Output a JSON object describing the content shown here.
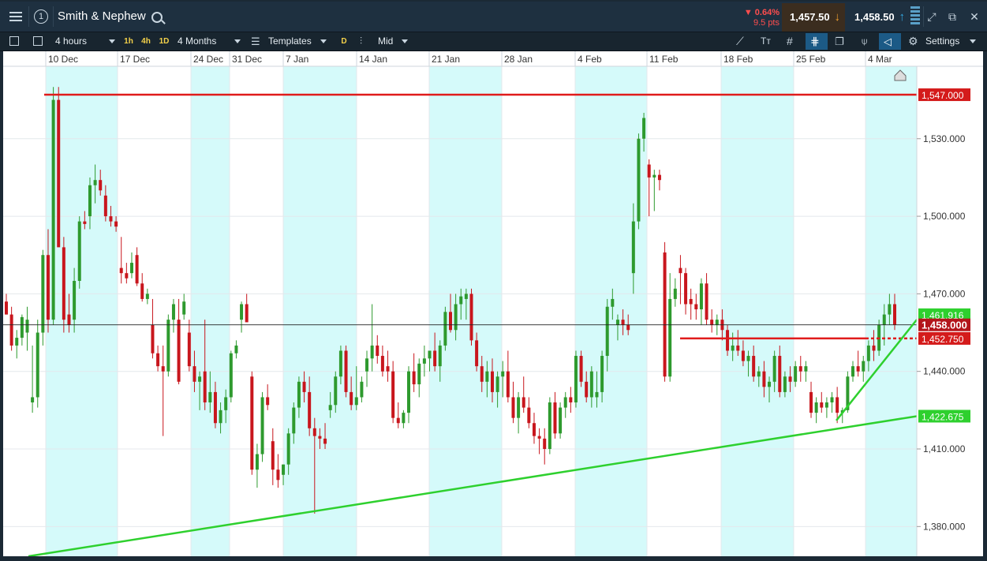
{
  "header": {
    "menu_icon": "hamburger-menu-icon",
    "workspace_number": "1",
    "instrument": "Smith & Nephew",
    "change_pct": "▼ 0.64%",
    "change_pts": "9.5 pts",
    "sell_price": "1,457.50",
    "buy_price": "1,458.50",
    "sell_arrow": "↓",
    "buy_arrow": "↑",
    "colors": {
      "down": "#ff4d4d",
      "sell_arrow": "#f0a030",
      "buy_arrow": "#34a8e0"
    }
  },
  "toolbar": {
    "interval": "4 hours",
    "quick_1": "1h",
    "quick_2": "4h",
    "quick_3": "1D",
    "range": "4 Months",
    "templates": "Templates",
    "d_chip": "D",
    "price_type": "Mid",
    "settings": "Settings"
  },
  "chart_data": {
    "type": "candlestick",
    "x_ticks": [
      "10 Dec",
      "17 Dec",
      "24 Dec",
      "31 Dec",
      "7 Jan",
      "14 Jan",
      "21 Jan",
      "28 Jan",
      "4 Feb",
      "11 Feb",
      "18 Feb",
      "25 Feb",
      "4 Mar"
    ],
    "y_ticks": [
      "1,530.000",
      "1,500.000",
      "1,470.000",
      "1,440.000",
      "1,410.000",
      "1,380.000"
    ],
    "y_tick_values": [
      1530,
      1500,
      1470,
      1440,
      1410,
      1380
    ],
    "ylim": [
      1368.5,
      1558
    ],
    "colors": {
      "up": "#2e9a2e",
      "down": "#c8161d",
      "weekend_band": "#d5fafa",
      "support": "#2ed02e",
      "resistance": "#e01b1b"
    },
    "price_labels": {
      "resistance": "1,547.000",
      "current": "1,458.000",
      "level": "1,452.750",
      "support": "1,422.675",
      "hidden": "1,461.916"
    },
    "levels": {
      "resistance": 1547,
      "current": 1458,
      "level": 1452.75,
      "support": 1422.675
    },
    "candles": [
      [
        1467,
        1470,
        1462,
        1462
      ],
      [
        1462,
        1465,
        1448,
        1450
      ],
      [
        1450,
        1456,
        1445,
        1453
      ],
      [
        1453,
        1462,
        1450,
        1461
      ],
      [
        1455,
        1465,
        1448,
        1460
      ],
      [
        1428,
        1450,
        1424,
        1430
      ],
      [
        1430,
        1460,
        1426,
        1455
      ],
      [
        1455,
        1487,
        1450,
        1485
      ],
      [
        1485,
        1495,
        1455,
        1460
      ],
      [
        1460,
        1550,
        1458,
        1545
      ],
      [
        1545,
        1550,
        1490,
        1488
      ],
      [
        1488,
        1492,
        1455,
        1460
      ],
      [
        1462,
        1470,
        1455,
        1458
      ],
      [
        1460,
        1480,
        1455,
        1475
      ],
      [
        1475,
        1500,
        1472,
        1498
      ],
      [
        1498,
        1502,
        1495,
        1497
      ],
      [
        1500,
        1515,
        1495,
        1512
      ],
      [
        1512,
        1520,
        1505,
        1514
      ],
      [
        1514,
        1518,
        1508,
        1510
      ],
      [
        1508,
        1512,
        1498,
        1500
      ],
      [
        1500,
        1504,
        1496,
        1498
      ],
      [
        1498,
        1500,
        1494,
        1496
      ],
      [
        1480,
        1492,
        1474,
        1478
      ],
      [
        1478,
        1482,
        1474,
        1476
      ],
      [
        1478,
        1486,
        1476,
        1482
      ],
      [
        1485,
        1488,
        1473,
        1474
      ],
      [
        1474,
        1478,
        1467,
        1468
      ],
      [
        1468,
        1472,
        1466,
        1470
      ],
      [
        1458,
        1468,
        1445,
        1447
      ],
      [
        1447,
        1450,
        1440,
        1442
      ],
      [
        1442,
        1450,
        1415,
        1440
      ],
      [
        1440,
        1462,
        1438,
        1460
      ],
      [
        1460,
        1468,
        1455,
        1466
      ],
      [
        1460,
        1468,
        1435,
        1436
      ],
      [
        1462,
        1470,
        1460,
        1467
      ],
      [
        1455,
        1460,
        1440,
        1442
      ],
      [
        1442,
        1448,
        1432,
        1436
      ],
      [
        1436,
        1440,
        1425,
        1438
      ],
      [
        1440,
        1460,
        1425,
        1428
      ],
      [
        1428,
        1440,
        1424,
        1432
      ],
      [
        1432,
        1436,
        1418,
        1420
      ],
      [
        1420,
        1428,
        1416,
        1425
      ],
      [
        1425,
        1433,
        1420,
        1430
      ],
      [
        1430,
        1448,
        1428,
        1447
      ],
      [
        1447,
        1452,
        1445,
        1450
      ],
      [
        1460,
        1467,
        1455,
        1466
      ],
      [
        1466,
        1470,
        1460,
        1459
      ],
      [
        1438,
        1440,
        1400,
        1402
      ],
      [
        1402,
        1412,
        1395,
        1408
      ],
      [
        1408,
        1432,
        1405,
        1430
      ],
      [
        1430,
        1435,
        1425,
        1427
      ],
      [
        1413,
        1418,
        1396,
        1402
      ],
      [
        1402,
        1408,
        1395,
        1398
      ],
      [
        1400,
        1404,
        1396,
        1404
      ],
      [
        1404,
        1418,
        1400,
        1416
      ],
      [
        1416,
        1428,
        1412,
        1426
      ],
      [
        1426,
        1438,
        1422,
        1436
      ],
      [
        1436,
        1440,
        1428,
        1432
      ],
      [
        1432,
        1438,
        1415,
        1418
      ],
      [
        1418,
        1422,
        1385,
        1415
      ],
      [
        1415,
        1418,
        1410,
        1414
      ],
      [
        1414,
        1420,
        1410,
        1412
      ],
      [
        1425,
        1432,
        1422,
        1427
      ],
      [
        1427,
        1440,
        1424,
        1438
      ],
      [
        1438,
        1450,
        1435,
        1448
      ],
      [
        1448,
        1450,
        1430,
        1432
      ],
      [
        1432,
        1438,
        1425,
        1427
      ],
      [
        1427,
        1442,
        1425,
        1430
      ],
      [
        1430,
        1438,
        1428,
        1436
      ],
      [
        1440,
        1448,
        1434,
        1445
      ],
      [
        1445,
        1466,
        1440,
        1450
      ],
      [
        1450,
        1454,
        1443,
        1446
      ],
      [
        1446,
        1450,
        1438,
        1440
      ],
      [
        1442,
        1448,
        1436,
        1440
      ],
      [
        1440,
        1444,
        1420,
        1422
      ],
      [
        1422,
        1428,
        1418,
        1420
      ],
      [
        1420,
        1425,
        1418,
        1424
      ],
      [
        1424,
        1442,
        1420,
        1440
      ],
      [
        1440,
        1447,
        1432,
        1435
      ],
      [
        1435,
        1445,
        1430,
        1443
      ],
      [
        1443,
        1450,
        1438,
        1445
      ],
      [
        1445,
        1448,
        1440,
        1448
      ],
      [
        1448,
        1455,
        1440,
        1442
      ],
      [
        1442,
        1452,
        1436,
        1450
      ],
      [
        1450,
        1465,
        1448,
        1463
      ],
      [
        1463,
        1470,
        1455,
        1456
      ],
      [
        1456,
        1470,
        1452,
        1466
      ],
      [
        1466,
        1472,
        1460,
        1469
      ],
      [
        1468,
        1472,
        1460,
        1470
      ],
      [
        1470,
        1472,
        1450,
        1452
      ],
      [
        1452,
        1455,
        1440,
        1442
      ],
      [
        1442,
        1446,
        1432,
        1436
      ],
      [
        1436,
        1444,
        1430,
        1440
      ],
      [
        1440,
        1445,
        1428,
        1432
      ],
      [
        1432,
        1440,
        1426,
        1438
      ],
      [
        1438,
        1444,
        1430,
        1440
      ],
      [
        1440,
        1448,
        1428,
        1430
      ],
      [
        1430,
        1436,
        1420,
        1422
      ],
      [
        1422,
        1432,
        1416,
        1430
      ],
      [
        1430,
        1438,
        1424,
        1426
      ],
      [
        1426,
        1430,
        1418,
        1420
      ],
      [
        1420,
        1424,
        1412,
        1415
      ],
      [
        1415,
        1418,
        1408,
        1414
      ],
      [
        1414,
        1418,
        1404,
        1410
      ],
      [
        1410,
        1430,
        1408,
        1428
      ],
      [
        1428,
        1432,
        1414,
        1416
      ],
      [
        1416,
        1428,
        1414,
        1426
      ],
      [
        1426,
        1432,
        1422,
        1430
      ],
      [
        1430,
        1434,
        1424,
        1428
      ],
      [
        1428,
        1448,
        1426,
        1446
      ],
      [
        1446,
        1448,
        1434,
        1436
      ],
      [
        1436,
        1440,
        1428,
        1430
      ],
      [
        1430,
        1442,
        1426,
        1440
      ],
      [
        1430,
        1440,
        1426,
        1432
      ],
      [
        1432,
        1448,
        1428,
        1446
      ],
      [
        1446,
        1468,
        1440,
        1465
      ],
      [
        1465,
        1472,
        1460,
        1468
      ],
      [
        1458,
        1462,
        1452,
        1460
      ],
      [
        1460,
        1464,
        1454,
        1458
      ],
      [
        1458,
        1462,
        1454,
        1456
      ],
      [
        1478,
        1505,
        1470,
        1498
      ],
      [
        1498,
        1532,
        1495,
        1530
      ],
      [
        1530,
        1540,
        1525,
        1538
      ],
      [
        1520,
        1522,
        1500,
        1515
      ],
      [
        1515,
        1518,
        1502,
        1516
      ],
      [
        1516,
        1518,
        1510,
        1514
      ],
      [
        1486,
        1490,
        1436,
        1438
      ],
      [
        1438,
        1478,
        1436,
        1468
      ],
      [
        1468,
        1476,
        1465,
        1472
      ],
      [
        1480,
        1485,
        1466,
        1478
      ],
      [
        1478,
        1480,
        1462,
        1466
      ],
      [
        1468,
        1472,
        1460,
        1466
      ],
      [
        1466,
        1470,
        1460,
        1464
      ],
      [
        1464,
        1476,
        1458,
        1474
      ],
      [
        1474,
        1478,
        1458,
        1460
      ],
      [
        1460,
        1464,
        1455,
        1458
      ],
      [
        1458,
        1462,
        1454,
        1460
      ],
      [
        1460,
        1464,
        1452,
        1456
      ],
      [
        1456,
        1458,
        1446,
        1448
      ],
      [
        1448,
        1455,
        1444,
        1450
      ],
      [
        1450,
        1456,
        1446,
        1448
      ],
      [
        1448,
        1452,
        1442,
        1444
      ],
      [
        1444,
        1448,
        1438,
        1446
      ],
      [
        1446,
        1450,
        1436,
        1438
      ],
      [
        1438,
        1442,
        1434,
        1440
      ],
      [
        1440,
        1444,
        1430,
        1434
      ],
      [
        1434,
        1438,
        1428,
        1436
      ],
      [
        1436,
        1448,
        1432,
        1446
      ],
      [
        1446,
        1450,
        1430,
        1432
      ],
      [
        1432,
        1440,
        1430,
        1438
      ],
      [
        1438,
        1442,
        1432,
        1436
      ],
      [
        1436,
        1444,
        1434,
        1442
      ],
      [
        1442,
        1446,
        1436,
        1440
      ],
      [
        1440,
        1444,
        1436,
        1442
      ],
      [
        1432,
        1436,
        1422,
        1424
      ],
      [
        1424,
        1430,
        1420,
        1428
      ],
      [
        1428,
        1432,
        1424,
        1426
      ],
      [
        1426,
        1430,
        1422,
        1428
      ],
      [
        1428,
        1432,
        1424,
        1430
      ],
      [
        1430,
        1434,
        1420,
        1424
      ],
      [
        1424,
        1426,
        1420,
        1425
      ],
      [
        1425,
        1440,
        1424,
        1438
      ],
      [
        1438,
        1444,
        1436,
        1442
      ],
      [
        1442,
        1448,
        1438,
        1440
      ],
      [
        1440,
        1446,
        1436,
        1444
      ],
      [
        1444,
        1452,
        1440,
        1450
      ],
      [
        1450,
        1456,
        1444,
        1448
      ],
      [
        1448,
        1460,
        1446,
        1458
      ],
      [
        1458,
        1466,
        1450,
        1462
      ],
      [
        1462,
        1470,
        1458,
        1466
      ],
      [
        1466,
        1470,
        1456,
        1458
      ]
    ]
  }
}
